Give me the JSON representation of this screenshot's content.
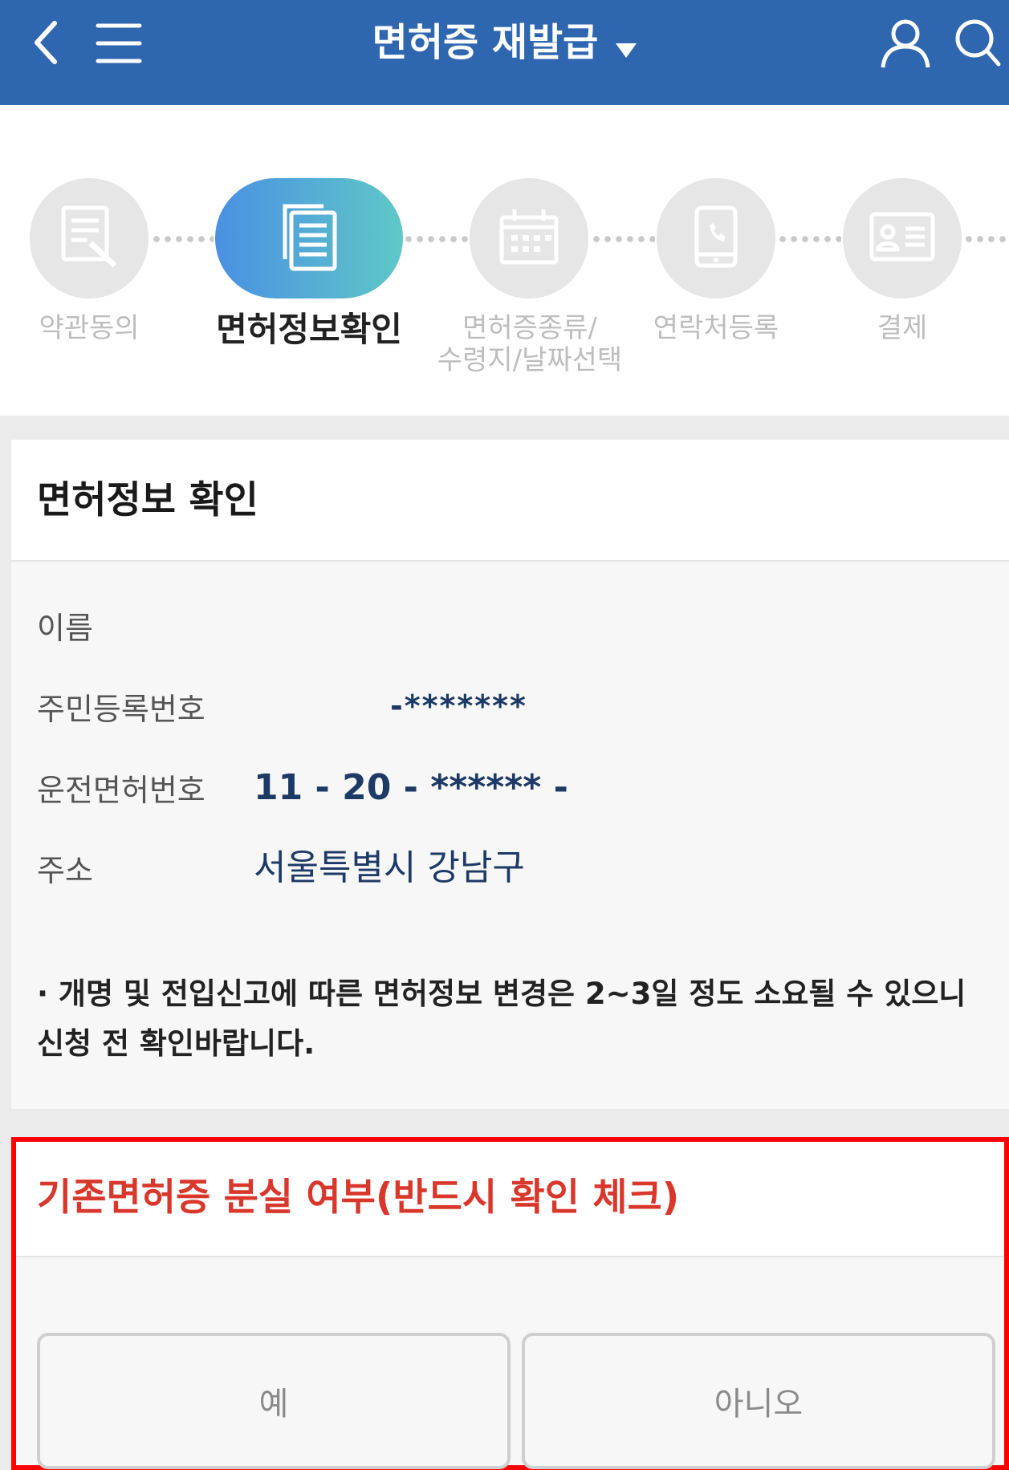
{
  "header": {
    "title": "면허증 재발급",
    "bg_color": "#2f66b0",
    "icons": [
      "back-icon",
      "menu-icon",
      "dropdown-caret-icon",
      "user-icon",
      "search-icon"
    ]
  },
  "steps": {
    "active_color_start": "#4a90e2",
    "active_color_end": "#5fc8c8",
    "items": [
      {
        "label": "약관동의",
        "icon": "document-edit-icon"
      },
      {
        "label": "면허정보확인",
        "icon": "document-copy-icon"
      },
      {
        "label": "면허증종류/\n수령지/날짜선택",
        "icon": "calendar-icon"
      },
      {
        "label": "연락처등록",
        "icon": "phone-icon"
      },
      {
        "label": "결제",
        "icon": "id-card-icon"
      }
    ]
  },
  "license_info": {
    "title": "면허정보 확인",
    "rows": [
      {
        "label": "이름",
        "value": ""
      },
      {
        "label": "주민등록번호",
        "value": "-*******"
      },
      {
        "label": "운전면허번호",
        "value": "11 - 20 - ****** -"
      },
      {
        "label": "주소",
        "value": "서울특별시 강남구"
      }
    ],
    "notice": "· 개명 및 전입신고에 따른 면허정보 변경은 2~3일 정도 소요될 수 있으니 신청 전 확인바랍니다."
  },
  "lost_check": {
    "title": "기존면허증 분실 여부(반드시 확인 체크)",
    "title_color": "#d9372b",
    "highlight_color": "#ff0000",
    "yes_label": "예",
    "no_label": "아니오"
  }
}
